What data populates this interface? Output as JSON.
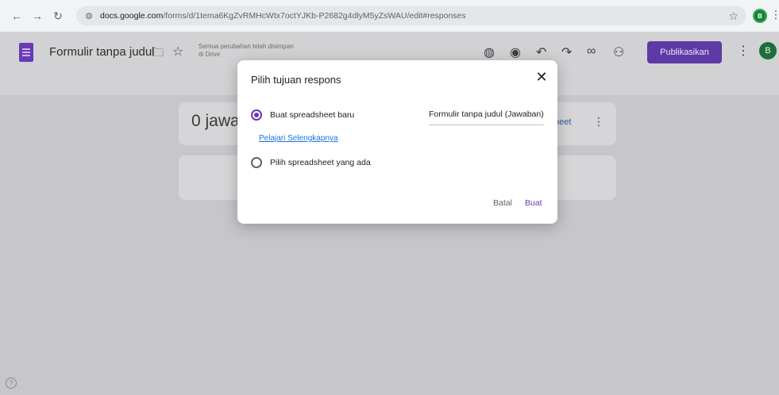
{
  "browser": {
    "url_domain": "docs.google.com",
    "url_path": "/forms/d/1tema6KgZvRMHcWtx7octYJKb-P2682g4dlyM5yZsWAU/edit#responses",
    "avatar_letter": "B"
  },
  "header": {
    "form_title": "Formulir tanpa judul",
    "save_status": "Semua perubahan telah disimpan di Drive",
    "publish_label": "Publikasikan",
    "avatar_letter": "B"
  },
  "content": {
    "responses_count": "0 jawa",
    "sheet_link": "heet"
  },
  "dialog": {
    "title": "Pilih tujuan respons",
    "option_new": "Buat spreadsheet baru",
    "new_sheet_name": "Formulir tanpa judul (Jawaban)",
    "learn_more": "Pelajari Selengkapnya",
    "option_existing": "Pilih spreadsheet yang ada",
    "cancel_label": "Batal",
    "create_label": "Buat"
  },
  "colors": {
    "accent": "#673ab7",
    "link": "#1a73e8"
  }
}
